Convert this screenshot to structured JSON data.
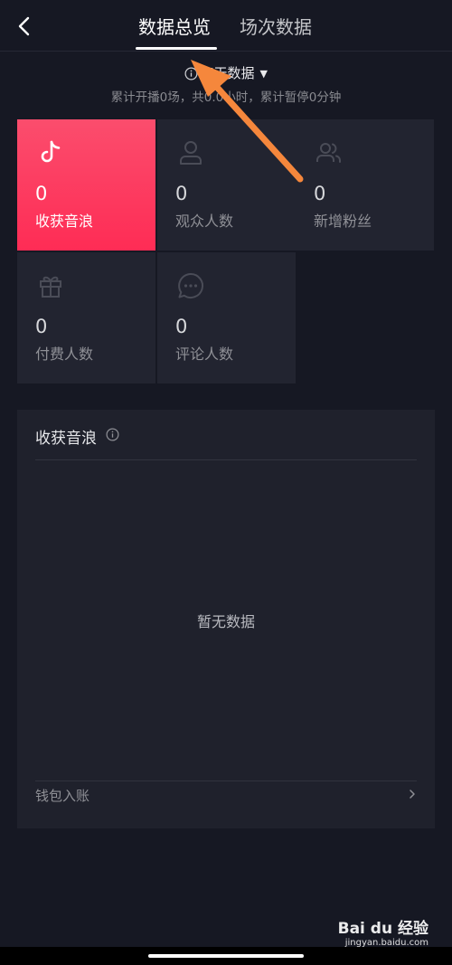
{
  "header": {
    "tabs": [
      {
        "label": "数据总览",
        "active": true
      },
      {
        "label": "场次数据",
        "active": false
      }
    ]
  },
  "range": {
    "selector_label": "7天数据",
    "summary": "累计开播0场，共0.0小时，累计暂停0分钟"
  },
  "metrics": [
    {
      "icon": "music-note-icon",
      "value": "0",
      "label": "收获音浪",
      "active": true
    },
    {
      "icon": "person-icon",
      "value": "0",
      "label": "观众人数",
      "active": false
    },
    {
      "icon": "people-icon",
      "value": "0",
      "label": "新增粉丝",
      "active": false
    },
    {
      "icon": "gift-icon",
      "value": "0",
      "label": "付费人数",
      "active": false
    },
    {
      "icon": "comment-icon",
      "value": "0",
      "label": "评论人数",
      "active": false
    }
  ],
  "panel": {
    "title": "收获音浪",
    "empty_text": "暂无数据",
    "wallet_label": "钱包入账"
  },
  "watermark": {
    "main": "Bai du 经验",
    "sub": "jingyan.baidu.com"
  },
  "colors": {
    "background": "#161823",
    "card": "#222430",
    "accent": "#fe2c55",
    "annotation_arrow": "#f5873c"
  }
}
